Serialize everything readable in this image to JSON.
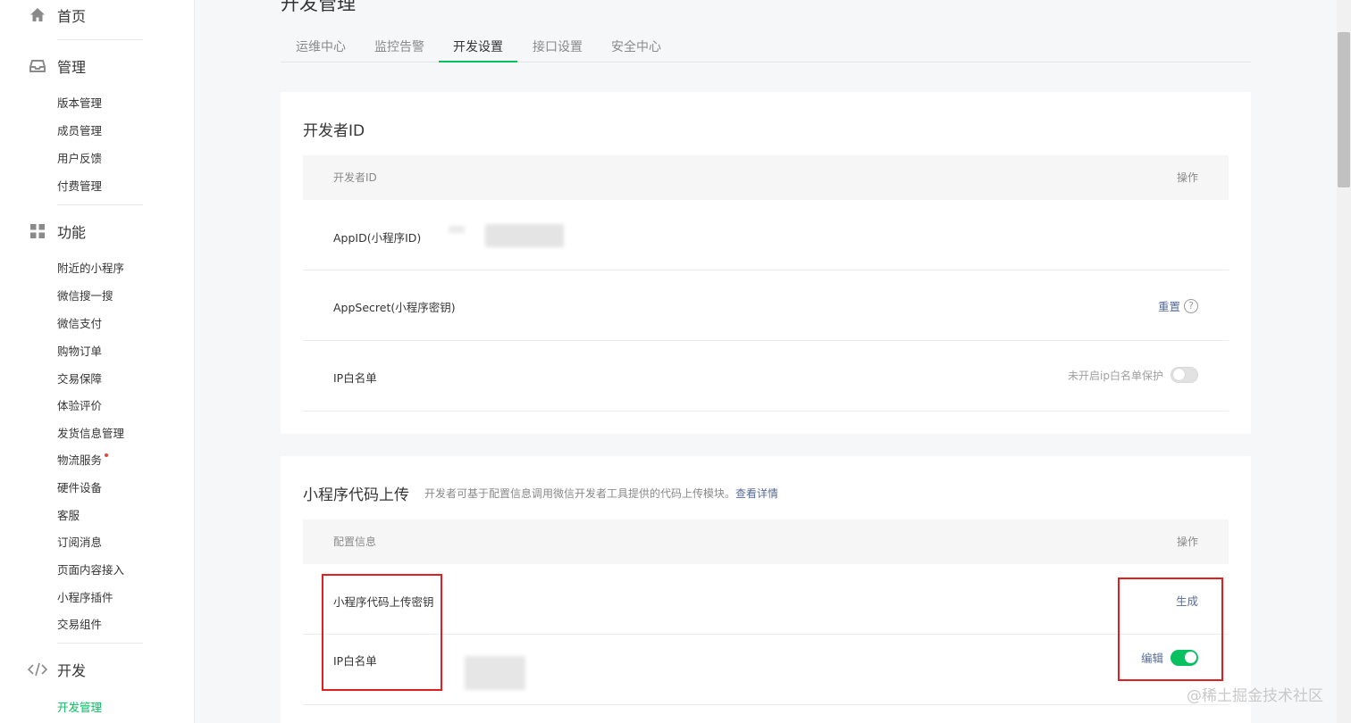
{
  "sidebar": {
    "home_label": "首页",
    "manage_label": "管理",
    "manage_items": [
      "版本管理",
      "成员管理",
      "用户反馈",
      "付费管理"
    ],
    "function_label": "功能",
    "function_items": [
      "附近的小程序",
      "微信搜一搜",
      "微信支付",
      "购物订单",
      "交易保障",
      "体验评价",
      "发货信息管理",
      "物流服务",
      "硬件设备",
      "客服",
      "订阅消息",
      "页面内容接入",
      "小程序插件",
      "交易组件"
    ],
    "dev_label": "开发",
    "dev_items": [
      "开发管理"
    ]
  },
  "page": {
    "title": "开发管理",
    "tabs": [
      "运维中心",
      "监控告警",
      "开发设置",
      "接口设置",
      "安全中心"
    ],
    "active_tab": "开发设置"
  },
  "developer_id": {
    "title": "开发者ID",
    "col_left": "开发者ID",
    "col_right": "操作",
    "appid_label": "AppID(小程序ID)",
    "appsecret_label": "AppSecret(小程序密钥)",
    "reset_label": "重置",
    "ip_label": "IP白名单",
    "ip_status": "未开启ip白名单保护"
  },
  "code_upload": {
    "title": "小程序代码上传",
    "desc": "开发者可基于配置信息调用微信开发者工具提供的代码上传模块。",
    "desc_link": "查看详情",
    "col_left": "配置信息",
    "col_right": "操作",
    "key_label": "小程序代码上传密钥",
    "generate_label": "生成",
    "ip_label": "IP白名单",
    "edit_label": "编辑"
  },
  "watermark": "@稀土掘金技术社区",
  "colors": {
    "accent": "#07c160",
    "link": "#576b95",
    "highlight": "#e02020"
  }
}
